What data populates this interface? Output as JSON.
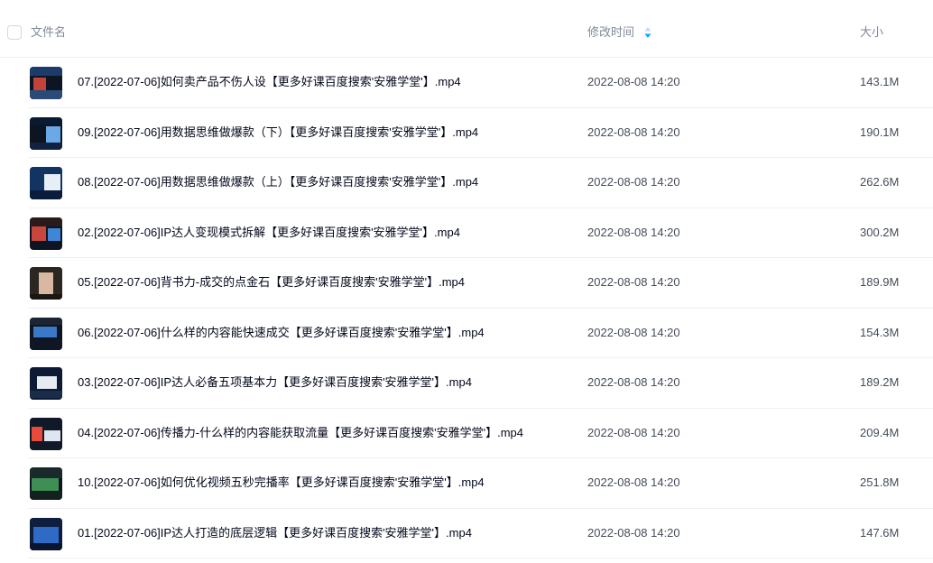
{
  "header": {
    "name_label": "文件名",
    "mtime_label": "修改时间",
    "size_label": "大小",
    "sort_icon": "sort-desc-icon"
  },
  "colors": {
    "accent": "#06a7ff",
    "border": "#f0f0f3",
    "text_primary": "#03081a",
    "text_secondary": "#454d5a",
    "header_text": "#818999"
  },
  "files": [
    {
      "name": "07.[2022-07-06]如何卖产品不伤人设【更多好课百度搜索'安雅学堂'】.mp4",
      "mtime": "2022-08-08 14:20",
      "size": "143.1M",
      "icon": "video-thumbnail"
    },
    {
      "name": "09.[2022-07-06]用数据思维做爆款（下）【更多好课百度搜索'安雅学堂'】.mp4",
      "mtime": "2022-08-08 14:20",
      "size": "190.1M",
      "icon": "video-thumbnail"
    },
    {
      "name": "08.[2022-07-06]用数据思维做爆款（上）【更多好课百度搜索'安雅学堂'】.mp4",
      "mtime": "2022-08-08 14:20",
      "size": "262.6M",
      "icon": "video-thumbnail"
    },
    {
      "name": "02.[2022-07-06]IP达人变现模式拆解【更多好课百度搜索'安雅学堂'】.mp4",
      "mtime": "2022-08-08 14:20",
      "size": "300.2M",
      "icon": "video-thumbnail"
    },
    {
      "name": "05.[2022-07-06]背书力-成交的点金石【更多好课百度搜索'安雅学堂'】.mp4",
      "mtime": "2022-08-08 14:20",
      "size": "189.9M",
      "icon": "video-thumbnail"
    },
    {
      "name": "06.[2022-07-06]什么样的内容能快速成交【更多好课百度搜索'安雅学堂'】.mp4",
      "mtime": "2022-08-08 14:20",
      "size": "154.3M",
      "icon": "video-thumbnail"
    },
    {
      "name": "03.[2022-07-06]IP达人必备五项基本力【更多好课百度搜索'安雅学堂'】.mp4",
      "mtime": "2022-08-08 14:20",
      "size": "189.2M",
      "icon": "video-thumbnail"
    },
    {
      "name": "04.[2022-07-06]传播力-什么样的内容能获取流量【更多好课百度搜索'安雅学堂'】.mp4",
      "mtime": "2022-08-08 14:20",
      "size": "209.4M",
      "icon": "video-thumbnail"
    },
    {
      "name": "10.[2022-07-06]如何优化视频五秒完播率【更多好课百度搜索'安雅学堂'】.mp4",
      "mtime": "2022-08-08 14:20",
      "size": "251.8M",
      "icon": "video-thumbnail"
    },
    {
      "name": "01.[2022-07-06]IP达人打造的底层逻辑【更多好课百度搜索'安雅学堂'】.mp4",
      "mtime": "2022-08-08 14:20",
      "size": "147.6M",
      "icon": "video-thumbnail"
    }
  ]
}
